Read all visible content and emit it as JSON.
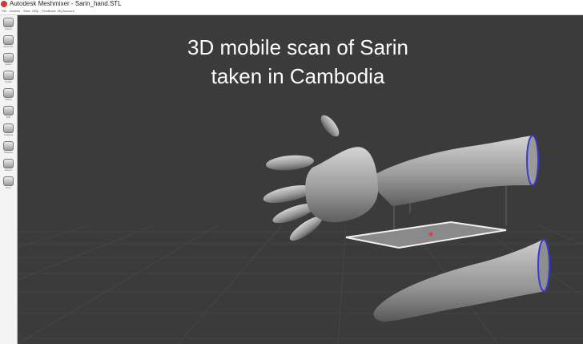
{
  "window": {
    "app_name": "Autodesk Meshmixer",
    "separator": " - ",
    "file_name": "Sarin_hand.STL"
  },
  "menu": [
    {
      "label": "File"
    },
    {
      "label": "Actions"
    },
    {
      "label": "View"
    },
    {
      "label": "Help"
    },
    {
      "label": "Feedback"
    },
    {
      "label": "My Account"
    }
  ],
  "tools": [
    {
      "label": "Import",
      "icon": "import-icon"
    },
    {
      "label": "Meshmix",
      "icon": "meshmix-icon"
    },
    {
      "label": "Select",
      "icon": "select-icon"
    },
    {
      "label": "Sculpt",
      "icon": "sculpt-icon"
    },
    {
      "label": "Stamp",
      "icon": "stamp-icon"
    },
    {
      "label": "Edit",
      "icon": "edit-icon"
    },
    {
      "label": "Analysis",
      "icon": "analysis-icon"
    },
    {
      "label": "Shaders",
      "icon": "shaders-icon"
    },
    {
      "label": "Export",
      "icon": "export-icon"
    },
    {
      "label": "Print",
      "icon": "print-icon"
    }
  ],
  "viewport": {
    "caption_line1": "3D mobile scan of Sarin",
    "caption_line2": "taken in Cambodia",
    "background_color": "#3b3b3b",
    "mesh_color": "#9c9c9c",
    "boundary_color": "#3a3ad0",
    "pivot_color": "#e04040"
  }
}
